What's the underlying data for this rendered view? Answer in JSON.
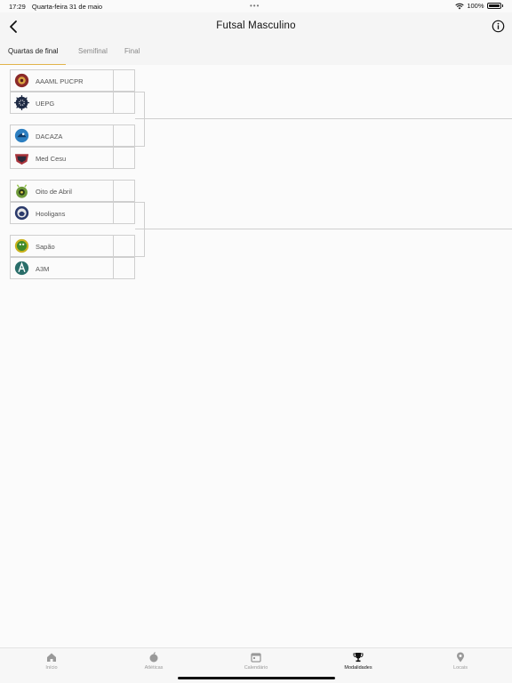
{
  "status_bar": {
    "time": "17:29",
    "date": "Quarta-feira 31 de maio",
    "dots": "•••",
    "battery": "100%"
  },
  "nav": {
    "title": "Futsal Masculino"
  },
  "tabs": [
    {
      "label": "Quartas de final",
      "active": true
    },
    {
      "label": "Semifinal",
      "active": false
    },
    {
      "label": "Final",
      "active": false
    }
  ],
  "bracket": {
    "matches": [
      {
        "teams": [
          {
            "name": "AAAML PUCPR",
            "logo_color": "#8b2a2a"
          },
          {
            "name": "UEPG",
            "logo_color": "#1e2a44"
          }
        ]
      },
      {
        "teams": [
          {
            "name": "DACAZA",
            "logo_color": "#2d7fc1"
          },
          {
            "name": "Med Cesu",
            "logo_color": "#a8323a"
          }
        ]
      },
      {
        "teams": [
          {
            "name": "Oito de Abril",
            "logo_color": "#6e9a3a"
          },
          {
            "name": "Hooligans",
            "logo_color": "#2b3a6b"
          }
        ]
      },
      {
        "teams": [
          {
            "name": "Sapão",
            "logo_color": "#c9b21e"
          },
          {
            "name": "A3M",
            "logo_color": "#2a6e6a"
          }
        ]
      }
    ]
  },
  "bottom_nav": [
    {
      "label": "Início",
      "icon": "home-icon",
      "active": false
    },
    {
      "label": "Atléticas",
      "icon": "bomb-icon",
      "active": false
    },
    {
      "label": "Calendário",
      "icon": "calendar-icon",
      "active": false
    },
    {
      "label": "Modalidades",
      "icon": "trophy-icon",
      "active": true
    },
    {
      "label": "Locais",
      "icon": "location-pin-icon",
      "active": false
    }
  ]
}
